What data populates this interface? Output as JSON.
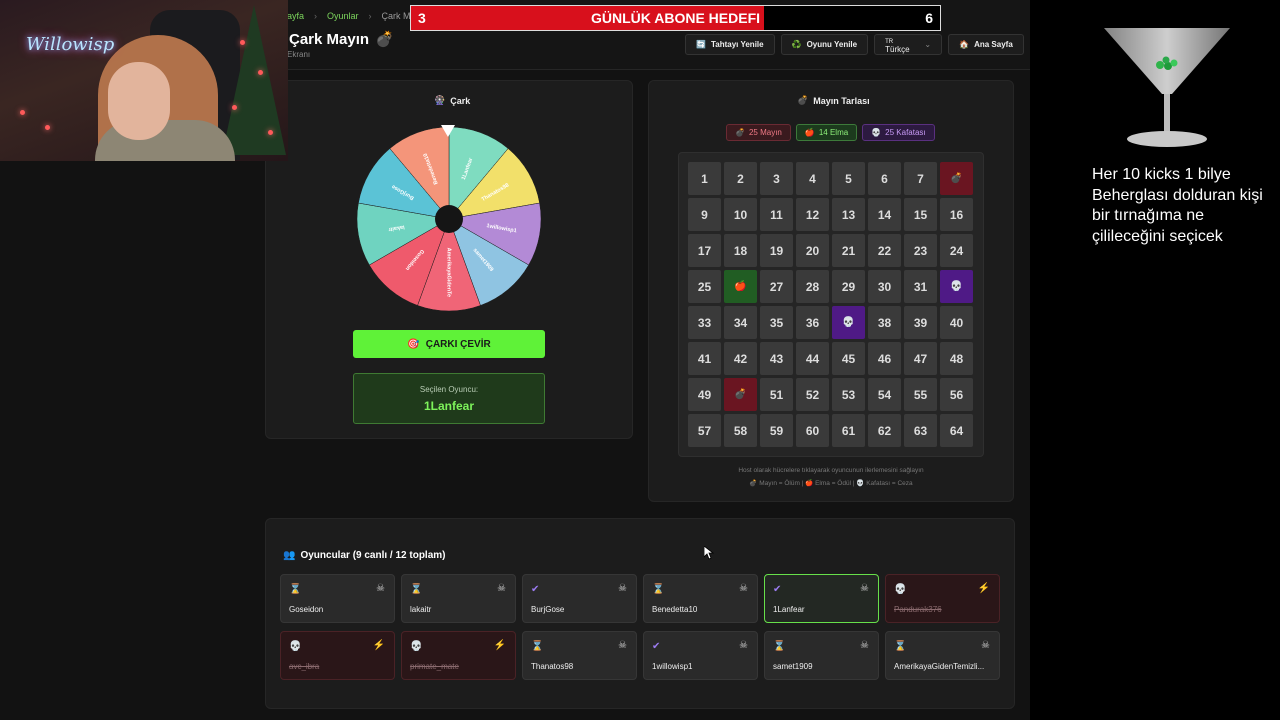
{
  "goal": {
    "current": "3",
    "label": "GÜNLÜK ABONE HEDEFI",
    "target": "6"
  },
  "header": {
    "breadcrumb": [
      "ayfa",
      "Oyunlar",
      "Çark Mayın"
    ],
    "title": "Çark Mayın",
    "title_icon": "💣",
    "subtitle": "Ekranı",
    "buttons": {
      "refresh_board": "Tahtayı Yenile",
      "refresh_board_icon": "🔄",
      "refresh_game": "Oyunu Yenile",
      "refresh_game_icon": "♻️",
      "language": "Türkçe",
      "language_code": "TR",
      "home": "Ana Sayfa",
      "home_icon": "🏠"
    }
  },
  "wheel": {
    "title": "Çark",
    "title_icon": "🎡",
    "segments": [
      {
        "name": "1Lanfear",
        "color": "#7fdcc0"
      },
      {
        "name": "Thanatos98",
        "color": "#f2e06a"
      },
      {
        "name": "1willowisp1",
        "color": "#b38ad6"
      },
      {
        "name": "samet1909",
        "color": "#8fc4e2"
      },
      {
        "name": "AmerikayaGidenTemizlikci",
        "color": "#f06577"
      },
      {
        "name": "Goseidon",
        "color": "#ef5a6c"
      },
      {
        "name": "lakaitr",
        "color": "#6fd3c0"
      },
      {
        "name": "BurjGose",
        "color": "#5bc3d6"
      },
      {
        "name": "Benedetta10",
        "color": "#f4957a"
      }
    ],
    "spin_button": "ÇARKI ÇEVİR",
    "spin_icon": "🎯",
    "selected_label": "Seçilen Oyuncu:",
    "selected_value": "1Lanfear"
  },
  "minefield": {
    "title": "Mayın Tarlası",
    "title_icon": "💣",
    "counts": {
      "mines": "25 Mayın",
      "apples": "14 Elma",
      "skulls": "25 Kafatası"
    },
    "cells": [
      {
        "n": "1"
      },
      {
        "n": "2"
      },
      {
        "n": "3"
      },
      {
        "n": "4"
      },
      {
        "n": "5"
      },
      {
        "n": "6"
      },
      {
        "n": "7"
      },
      {
        "n": "",
        "type": "mine"
      },
      {
        "n": "9"
      },
      {
        "n": "10"
      },
      {
        "n": "11"
      },
      {
        "n": "12"
      },
      {
        "n": "13"
      },
      {
        "n": "14"
      },
      {
        "n": "15"
      },
      {
        "n": "16"
      },
      {
        "n": "17"
      },
      {
        "n": "18"
      },
      {
        "n": "19"
      },
      {
        "n": "20"
      },
      {
        "n": "21"
      },
      {
        "n": "22"
      },
      {
        "n": "23"
      },
      {
        "n": "24"
      },
      {
        "n": "25"
      },
      {
        "n": "",
        "type": "apple"
      },
      {
        "n": "27"
      },
      {
        "n": "28"
      },
      {
        "n": "29"
      },
      {
        "n": "30"
      },
      {
        "n": "31"
      },
      {
        "n": "",
        "type": "skull"
      },
      {
        "n": "33"
      },
      {
        "n": "34"
      },
      {
        "n": "35"
      },
      {
        "n": "36"
      },
      {
        "n": "",
        "type": "skull"
      },
      {
        "n": "38"
      },
      {
        "n": "39"
      },
      {
        "n": "40"
      },
      {
        "n": "41"
      },
      {
        "n": "42"
      },
      {
        "n": "43"
      },
      {
        "n": "44"
      },
      {
        "n": "45"
      },
      {
        "n": "46"
      },
      {
        "n": "47"
      },
      {
        "n": "48"
      },
      {
        "n": "49"
      },
      {
        "n": "",
        "type": "mine"
      },
      {
        "n": "51"
      },
      {
        "n": "52"
      },
      {
        "n": "53"
      },
      {
        "n": "54"
      },
      {
        "n": "55"
      },
      {
        "n": "56"
      },
      {
        "n": "57"
      },
      {
        "n": "58"
      },
      {
        "n": "59"
      },
      {
        "n": "60"
      },
      {
        "n": "61"
      },
      {
        "n": "62"
      },
      {
        "n": "63"
      },
      {
        "n": "64"
      }
    ],
    "hint_line1": "Host olarak hücrelere tıklayarak oyuncunun ilerlemesini sağlayın",
    "hint_line2": "💣 Mayın = Ölüm | 🍎 Elma = Ödül | 💀 Kafatası = Ceza"
  },
  "players": {
    "title": "Oyuncular (9 canlı / 12 toplam)",
    "title_icon": "👥",
    "list": [
      {
        "name": "Goseidon",
        "status": "waiting"
      },
      {
        "name": "lakaitr",
        "status": "waiting"
      },
      {
        "name": "BurjGose",
        "status": "done"
      },
      {
        "name": "Benedetta10",
        "status": "waiting"
      },
      {
        "name": "1Lanfear",
        "status": "active"
      },
      {
        "name": "Pandurak376",
        "status": "dead"
      },
      {
        "name": "avc_ibra",
        "status": "dead"
      },
      {
        "name": "primate_mate",
        "status": "dead"
      },
      {
        "name": "Thanatos98",
        "status": "waiting"
      },
      {
        "name": "1willowisp1",
        "status": "done"
      },
      {
        "name": "samet1909",
        "status": "waiting"
      },
      {
        "name": "AmerikayaGidenTemizli...",
        "status": "waiting"
      }
    ]
  },
  "overlay": {
    "text": "Her 10 kicks 1 bilye Beherglası dolduran kişi bir tırnağıma ne çilileceğini seçicek",
    "webcam_neon": "Willowisp"
  }
}
